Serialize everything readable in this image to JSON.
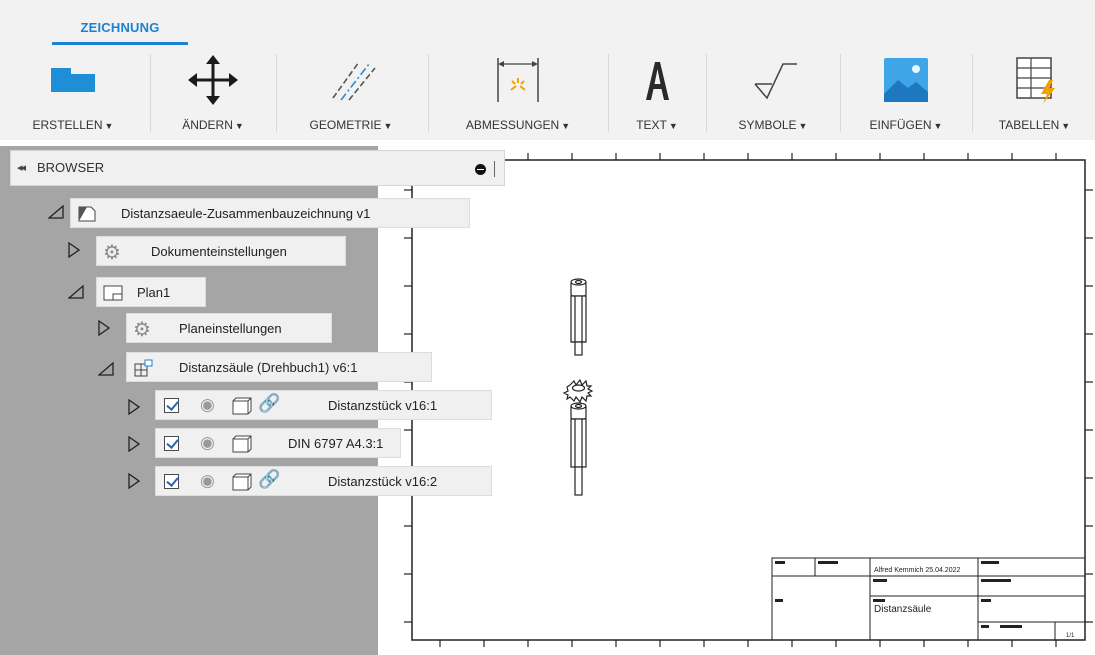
{
  "ribbon": {
    "active_tab": "ZEICHNUNG",
    "accent_color": "#1b82d2",
    "tools": [
      {
        "label": "ERSTELLEN",
        "icon": "create-sheet-icon",
        "has_dropdown": true
      },
      {
        "label": "ÄNDERN",
        "icon": "move-arrows-icon",
        "has_dropdown": true
      },
      {
        "label": "GEOMETRIE",
        "icon": "centerline-geometry-icon",
        "has_dropdown": true
      },
      {
        "label": "ABMESSUNGEN",
        "icon": "dimension-icon",
        "has_dropdown": true
      },
      {
        "label": "TEXT",
        "icon": "text-icon",
        "has_dropdown": true
      },
      {
        "label": "SYMBOLE",
        "icon": "surface-texture-symbol-icon",
        "has_dropdown": true
      },
      {
        "label": "EINFÜGEN",
        "icon": "insert-image-icon",
        "has_dropdown": true
      },
      {
        "label": "TABELLEN",
        "icon": "table-icon",
        "has_dropdown": true
      }
    ]
  },
  "browser": {
    "title": "BROWSER",
    "collapse_glyph": "◂◂",
    "tree": {
      "root": "Distanzsaeule-Zusammenbauzeichnung v1",
      "document_settings": "Dokumenteinstellungen",
      "sheet": "Plan1",
      "sheet_settings": "Planeinstellungen",
      "view": "Distanzsäule (Drehbuch1) v6:1",
      "components": [
        {
          "label": "Distanzstück v16:1",
          "checked": true,
          "linked": true
        },
        {
          "label": "DIN 6797 A4.3:1",
          "checked": true,
          "linked": false
        },
        {
          "label": "Distanzstück v16:2",
          "checked": true,
          "linked": true
        }
      ]
    }
  },
  "drawing": {
    "title_block": {
      "author_date": "Alfred Kemmich 25.04.2022",
      "part_name": "Distanzsäule",
      "sheet_number": "1/1"
    }
  }
}
